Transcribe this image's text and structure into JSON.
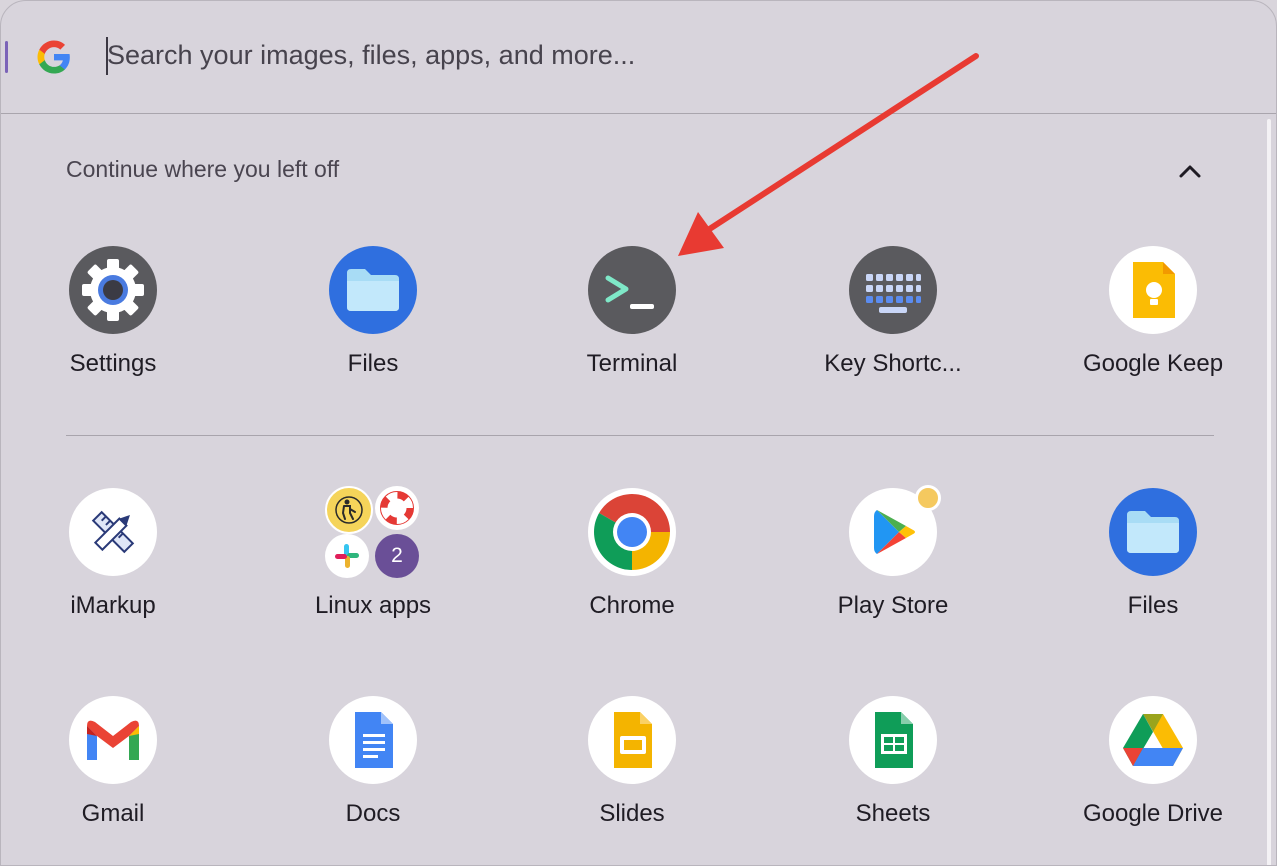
{
  "search": {
    "placeholder": "Search your images, files, apps, and more..."
  },
  "section": {
    "title": "Continue where you left off",
    "collapse_icon": "chevron-up-icon"
  },
  "recent_apps": [
    {
      "label": "Settings",
      "icon": "settings-icon"
    },
    {
      "label": "Files",
      "icon": "files-icon"
    },
    {
      "label": "Terminal",
      "icon": "terminal-icon"
    },
    {
      "label": "Key Shortc...",
      "icon": "keyboard-shortcuts-icon"
    },
    {
      "label": "Google Keep",
      "icon": "google-keep-icon"
    }
  ],
  "apps": [
    {
      "label": "iMarkup",
      "icon": "imarkup-icon"
    },
    {
      "label": "Linux apps",
      "icon": "linux-apps-folder-icon",
      "badge": "2"
    },
    {
      "label": "Chrome",
      "icon": "chrome-icon"
    },
    {
      "label": "Play Store",
      "icon": "play-store-icon"
    },
    {
      "label": "Files",
      "icon": "files-icon"
    },
    {
      "label": "Gmail",
      "icon": "gmail-icon"
    },
    {
      "label": "Docs",
      "icon": "docs-icon"
    },
    {
      "label": "Slides",
      "icon": "slides-icon"
    },
    {
      "label": "Sheets",
      "icon": "sheets-icon"
    },
    {
      "label": "Google Drive",
      "icon": "google-drive-icon"
    }
  ],
  "colors": {
    "background": "#d8d4dc",
    "annotation_arrow": "#e83a32",
    "accent": "#2f6fdf"
  }
}
